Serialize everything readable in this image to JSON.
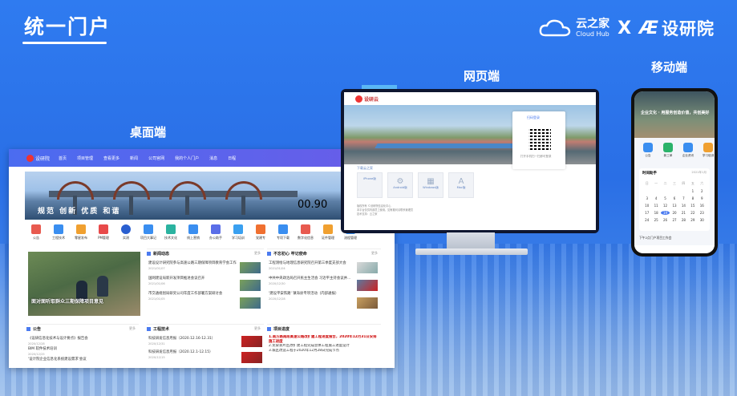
{
  "header": {
    "title": "统一门户",
    "brand_cloud_cn": "云之家",
    "brand_cloud_en": "Cloud Hub",
    "brand_times": "X",
    "brand_partner": "设研院"
  },
  "labels": {
    "desktop": "桌面端",
    "web": "网页端",
    "mobile": "移动端"
  },
  "desktop": {
    "logo": "设研院",
    "nav": [
      "首页",
      "项目管理",
      "查看更多",
      "新闻",
      "公司官网",
      "我的个人门户",
      "消息",
      "日程"
    ],
    "banner_slogan": "规范  创新  优质  和谐",
    "banner_number": "00.90",
    "icons": [
      "公告",
      "工程技术",
      "零星发布",
      "PM管理",
      "实测",
      "项目大事记",
      "技术文化",
      "线上营销",
      "办公助手",
      "学习培训",
      "党建专",
      "专项下载",
      "数字化信息",
      "证件管理",
      "流程管理"
    ],
    "news_title": "新闻动态",
    "focus_title": "不忘初心 牢记使命",
    "photo_caption": "面对面听取群众三期保障项目意见",
    "more": "更多",
    "news_items": [
      "建设设计研究院参与高速公路三期保障项目教育学会工作小记",
      "国网建设局新开发项目推进会议召开",
      "市交通规划局研究公司年度工作部署方案研讨会"
    ],
    "focus_items": [
      "工程测绘与地理信息研究院召开第三季度支部大会",
      "中共中央政治局召开民主生活会 习近平主持会议并...",
      "'建设平安铁路' 镇海县专项活动（内部通报）"
    ],
    "notice_title": "公告",
    "notice_items": [
      "《设研信息化技术与设计要点》报告会",
      "BIM 软件技术培训",
      "'设计院企业信息化系统建设需求'会议"
    ],
    "tech_title": "工程技术",
    "tech_items": [
      "科技研发信息月报（2020.12.16-12.31）",
      "科技研发信息月报（2020.12.1-12.15）"
    ],
    "progress_title": "项目进度",
    "progress_items": [
      "1.南方路南段高速公路改扩建工程进度报告，2020年12月31日安排施工进度",
      "2.龙泉县片区改扩建工程完成总体工程施工进度设计",
      "3.城区改造工程于2020年12月28日完成节点"
    ]
  },
  "web": {
    "logo": "设研云",
    "login_tab": "扫码登录",
    "login_hint": "打开手机扫一扫即可登录",
    "download_title": "下载云之家",
    "apps": [
      "iPhone版",
      "Android版",
      "Windows版",
      "Mac版"
    ],
    "footer": [
      "版权所有 ©设研院信息化中心",
      "本平台仅供内部员工使用，如有疑问请联系管理员",
      "技术支持：云之家"
    ]
  },
  "mobile": {
    "hero_text": "企业文化 · 用服务创造价值，共创美好",
    "icons": [
      "公告",
      "新工单",
      "企业资讯",
      "学习培训"
    ],
    "calendar_title": "时间助手",
    "calendar_month": "2021年1月",
    "weekdays": [
      "日",
      "一",
      "二",
      "三",
      "四",
      "五",
      "六"
    ],
    "days": [
      "",
      "",
      "",
      "",
      "",
      "1",
      "2",
      "3",
      "4",
      "5",
      "6",
      "7",
      "8",
      "9",
      "10",
      "11",
      "12",
      "13",
      "14",
      "15",
      "16",
      "17",
      "18",
      "19",
      "20",
      "21",
      "22",
      "23",
      "24",
      "25",
      "26",
      "27",
      "28",
      "29",
      "30"
    ],
    "selected_day": "19",
    "task": "下午2点门户项目工作会"
  }
}
